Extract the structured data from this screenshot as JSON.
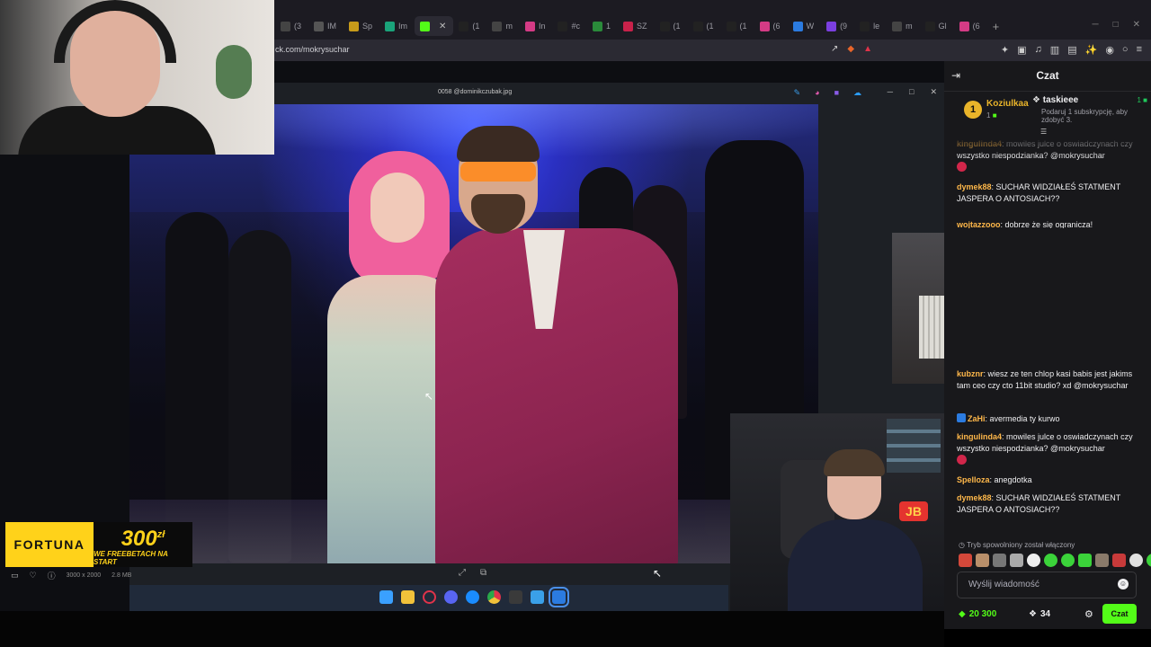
{
  "browser": {
    "tabs": [
      {
        "label": "(3",
        "color": "#444"
      },
      {
        "label": "IM",
        "color": "#555"
      },
      {
        "label": "Sp",
        "color": "#c79b1a"
      },
      {
        "label": "Im",
        "color": "#1aa37a"
      },
      {
        "label": "",
        "color": "#53fc18",
        "active": true
      },
      {
        "label": "(1",
        "color": "#222"
      },
      {
        "label": "m",
        "color": "#444"
      },
      {
        "label": "In",
        "color": "#d43b85"
      },
      {
        "label": "#с",
        "color": "#222"
      },
      {
        "label": "1",
        "color": "#2a8a3a"
      },
      {
        "label": "SZ",
        "color": "#c8224a"
      },
      {
        "label": "(1",
        "color": "#222"
      },
      {
        "label": "(1",
        "color": "#222"
      },
      {
        "label": "(1",
        "color": "#222"
      },
      {
        "label": "(6",
        "color": "#d43b85"
      },
      {
        "label": "W",
        "color": "#2b7be0"
      },
      {
        "label": "(9",
        "color": "#7b3fe0"
      },
      {
        "label": "le",
        "color": "#222"
      },
      {
        "label": "m",
        "color": "#444"
      },
      {
        "label": "Gl",
        "color": "#222"
      },
      {
        "label": "(6",
        "color": "#d43b85"
      }
    ],
    "url": "ck.com/mokrysuchar"
  },
  "viewer": {
    "title": "0058 @dominikczubak.jpg",
    "dimensions": "3000 x 2000",
    "filesize": "2.8 MB"
  },
  "sponsor": {
    "brand": "FORTUNA",
    "amount": "300",
    "currency": "zł",
    "tagline": "WE FREEBETACH NA START"
  },
  "chat": {
    "title": "Czat",
    "gift_rank": "1",
    "gift_top_user": "Koziulkaa",
    "gift_top_count": "1",
    "gift_user": "taskieee",
    "gift_user_count": "1",
    "gift_desc": "Podaruj 1 subskrypcję, aby zdobyć 3.",
    "partial_top": "dobrze że się ogranicza!",
    "messages": [
      {
        "user": "kingulinda4",
        "color": "#ffb84a",
        "text": "mowiles julce o oswiadczynach czy wszystko niespodzianka? @mokrysuchar",
        "emote": true
      },
      {
        "user": "dymek88",
        "color": "#ffb84a",
        "text": "SUCHAR WIDZIAŁEŚ STATMENT JASPERA O ANTOSIACH??"
      },
      {
        "user": "wojtazzooo",
        "color": "#ffb84a",
        "text": "dobrze że się ogranicza!"
      },
      {
        "user": "kubznr",
        "color": "#ffb84a",
        "text": "wiesz ze ten chlop kasi babis jest jakims tam ceo czy cto 11bit studio? xd @mokrysuchar"
      },
      {
        "user": "ZaHi",
        "color": "#ffb84a",
        "text": "avermedia ty kurwo",
        "badge": true
      },
      {
        "user": "kingulinda4",
        "color": "#ffb84a",
        "text": "mowiles julce o oswiadczynach czy wszystko niespodzianka? @mokrysuchar",
        "emote": true
      },
      {
        "user": "Spelloza",
        "color": "#ffb84a",
        "text": "anegdotka"
      },
      {
        "user": "dymek88",
        "color": "#ffb84a",
        "text": "SUCHAR WIDZIAŁEŚ STATMENT JASPERA O ANTOSIACH??"
      }
    ],
    "slow_mode": "Tryb spowolniony został włączony",
    "input_placeholder": "Wyślij wiadomość",
    "points": "20 300",
    "subs": "34",
    "send_label": "Czat",
    "accent": "#53fc18"
  }
}
